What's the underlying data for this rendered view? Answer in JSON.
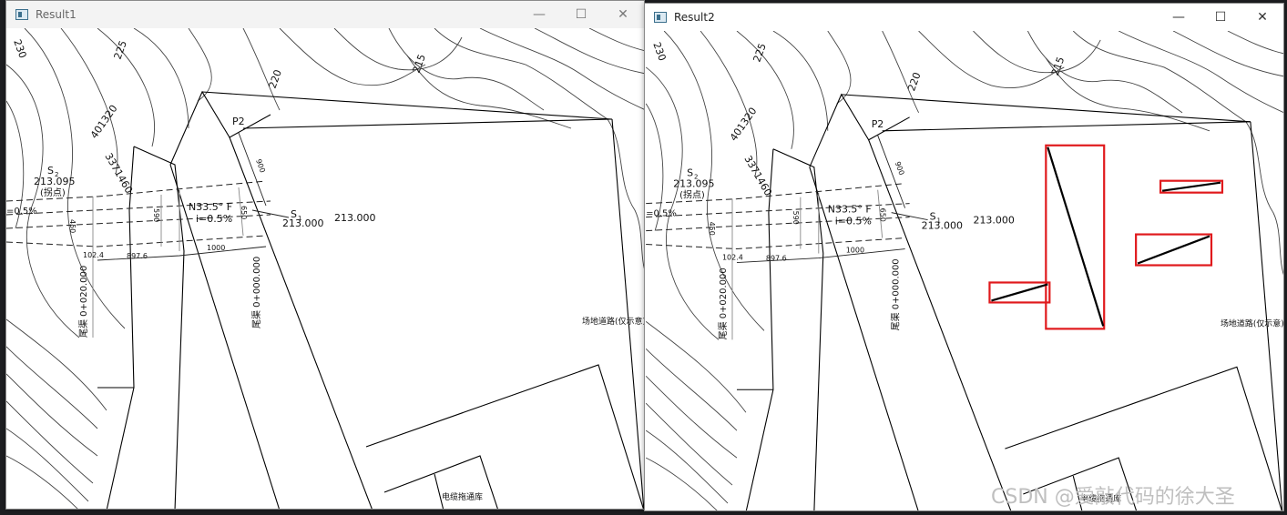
{
  "windows": [
    {
      "title": "Result1"
    },
    {
      "title": "Result2"
    }
  ],
  "controls": {
    "minimize": "—",
    "maximize": "☐",
    "close": "✕"
  },
  "drawing": {
    "contours": [
      "230",
      "225",
      "220",
      "215"
    ],
    "coord1": "401320",
    "coord2": "3371460",
    "s2_label": "S",
    "s2_sub": "2",
    "s2_elev": "213.095",
    "s2_note": "(拐点)",
    "grade_left": "=0.5%",
    "direction": "N33.5° F",
    "grade": "i=0.5%",
    "p2": "P2",
    "s1_label": "S",
    "s1_sub": "1",
    "s1_elev": "213.000",
    "elev_main": "213.000",
    "dim_900": "900",
    "dim_450": "450",
    "dim_590": "590",
    "dim_650": "650",
    "dim_1000": "1000",
    "dim_1024": "102.4",
    "dim_8976": "897.6",
    "station_left": "尾渠  0+020.000",
    "station_right": "尾渠  0+000.000",
    "road_note": "场地道路(仅示意)",
    "building": "电缆拖通库"
  },
  "watermark": "CSDN @爱敲代码的徐大圣",
  "colors": {
    "highlight": "#e0191c",
    "line": "#000000"
  }
}
